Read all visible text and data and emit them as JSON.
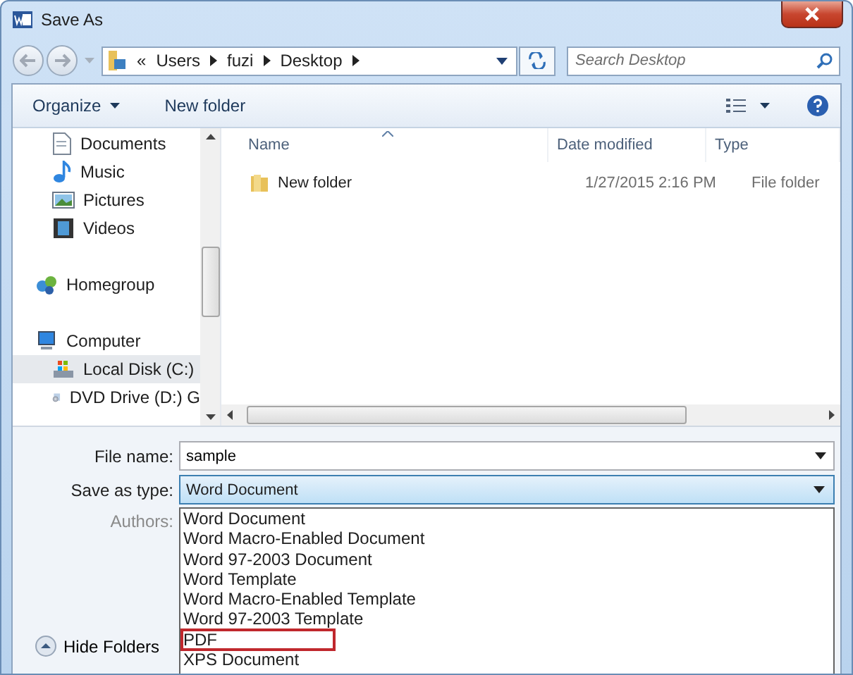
{
  "window": {
    "title": "Save As"
  },
  "address": {
    "overflow": "«",
    "crumbs": [
      "Users",
      "fuzi",
      "Desktop"
    ]
  },
  "search": {
    "placeholder": "Search Desktop"
  },
  "toolbar": {
    "organize": "Organize",
    "new_folder": "New folder"
  },
  "sidebar": {
    "groups": [
      {
        "children": [
          {
            "label": "Documents",
            "kind": "document",
            "selected": false
          },
          {
            "label": "Music",
            "kind": "music",
            "selected": false
          },
          {
            "label": "Pictures",
            "kind": "pictures",
            "selected": false
          },
          {
            "label": "Videos",
            "kind": "videos",
            "selected": false
          }
        ]
      },
      {
        "label": "Homegroup",
        "kind": "homegroup"
      },
      {
        "label": "Computer",
        "kind": "computer",
        "children": [
          {
            "label": "Local Disk (C:)",
            "kind": "disk",
            "selected": true
          },
          {
            "label": "DVD Drive (D:) G",
            "kind": "dvd",
            "selected": false
          }
        ]
      }
    ]
  },
  "file_list": {
    "columns": [
      "Name",
      "Date modified",
      "Type"
    ],
    "rows": [
      {
        "name": "New folder",
        "date": "1/27/2015 2:16 PM",
        "type": "File folder"
      }
    ]
  },
  "form": {
    "file_name_label": "File name:",
    "file_name": "sample",
    "type_label": "Save as type:",
    "type_value": "Word Document",
    "authors_label": "Authors:"
  },
  "type_options": [
    {
      "label": "Word Document",
      "highlighted": false
    },
    {
      "label": "Word Macro-Enabled Document",
      "highlighted": false
    },
    {
      "label": "Word 97-2003 Document",
      "highlighted": false
    },
    {
      "label": "Word Template",
      "highlighted": false
    },
    {
      "label": "Word Macro-Enabled Template",
      "highlighted": false
    },
    {
      "label": "Word 97-2003 Template",
      "highlighted": false
    },
    {
      "label": "PDF",
      "highlighted": true
    },
    {
      "label": "XPS Document",
      "highlighted": false
    }
  ],
  "hide_folders": "Hide Folders"
}
